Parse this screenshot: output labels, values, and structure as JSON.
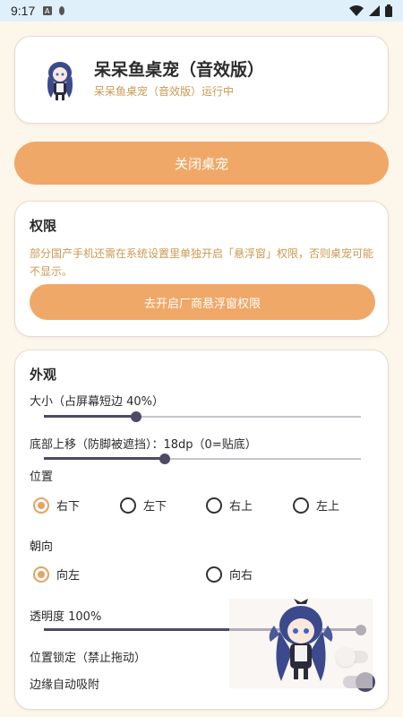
{
  "status_bar": {
    "time": "9:17",
    "icons": [
      "notification-a-icon",
      "notification-dot-icon",
      "wifi-icon",
      "signal-icon",
      "battery-icon"
    ]
  },
  "app": {
    "title": "呆呆鱼桌宠（音效版）",
    "subtitle": "呆呆鱼桌宠（音效版）运行中"
  },
  "close_button": "关闭桌宠",
  "permission": {
    "title": "权限",
    "description": "部分国产手机还需在系统设置里单独开启「悬浮窗」权限，否则桌宠可能不显示。",
    "button": "去开启厂商悬浮窗权限"
  },
  "appearance": {
    "title": "外观",
    "size": {
      "label": "大小（占屏幕短边 40%）",
      "value": 0.29
    },
    "bottom_offset": {
      "label": "底部上移（防脚被遮挡）：18dp（0=贴底）",
      "value": 0.38
    },
    "position": {
      "label": "位置",
      "options": [
        "右下",
        "左下",
        "右上",
        "左上"
      ],
      "selected": "右下"
    },
    "orientation": {
      "label": "朝向",
      "options": [
        "向左",
        "向右"
      ],
      "selected": "向左"
    },
    "opacity": {
      "label": "透明度 100%",
      "value": 1.0
    },
    "lock_position": {
      "label": "位置锁定（禁止拖动）",
      "on": false
    },
    "edge_snap": {
      "label": "边缘自动吸附",
      "on": true
    }
  },
  "colors": {
    "accent": "#f0a868",
    "hint": "#c99a52",
    "slider": "#4d4a66",
    "background": "#fdf6ea"
  }
}
